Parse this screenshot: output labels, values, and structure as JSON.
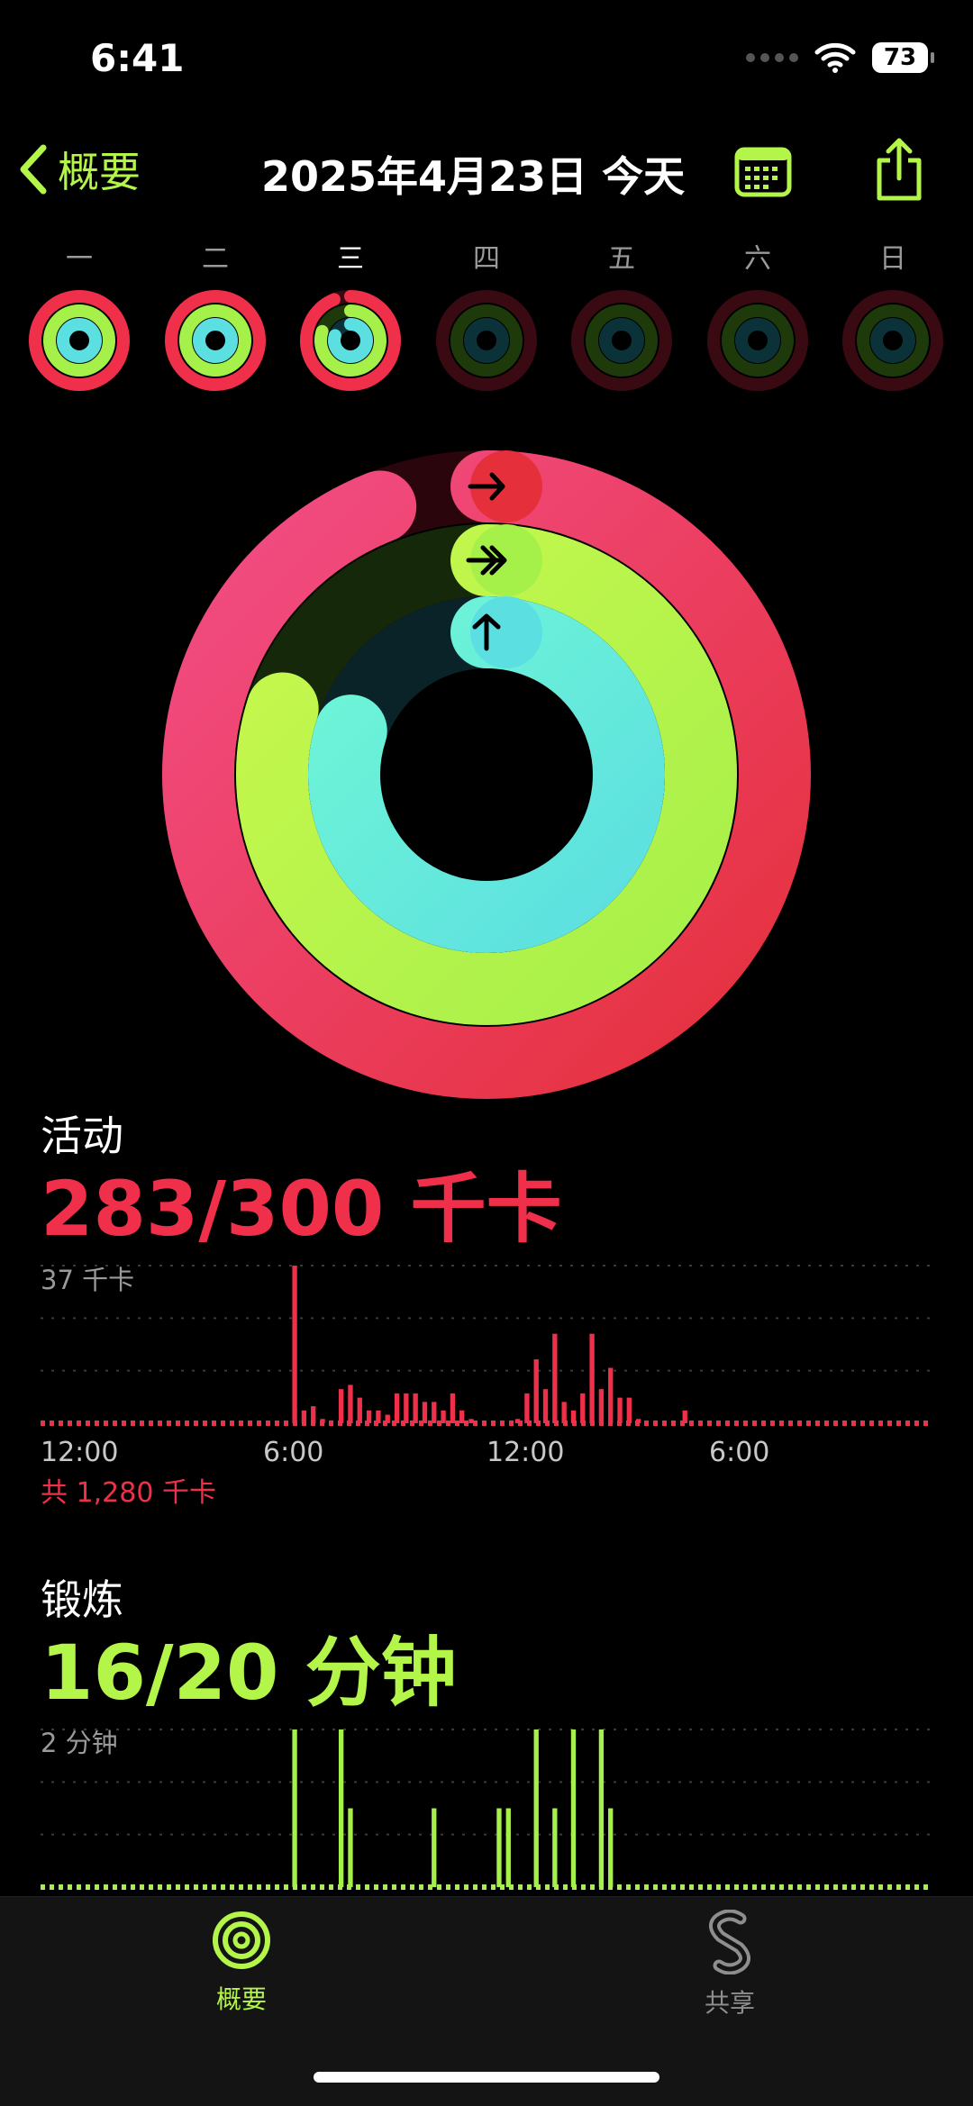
{
  "status": {
    "time": "6:41",
    "battery": "73"
  },
  "nav": {
    "back_label": "概要",
    "title": "2025年4月23日 今天"
  },
  "week": {
    "days": [
      "一",
      "二",
      "三",
      "四",
      "五",
      "六",
      "日"
    ],
    "today_index": 2,
    "rings": [
      {
        "move": 1.0,
        "exercise": 1.0,
        "stand": 1.0
      },
      {
        "move": 1.0,
        "exercise": 1.0,
        "stand": 1.0
      },
      {
        "move": 0.94,
        "exercise": 0.8,
        "stand": 0.8
      },
      {
        "move": 0,
        "exercise": 0,
        "stand": 0
      },
      {
        "move": 0,
        "exercise": 0,
        "stand": 0
      },
      {
        "move": 0,
        "exercise": 0,
        "stand": 0
      },
      {
        "move": 0,
        "exercise": 0,
        "stand": 0
      }
    ]
  },
  "rings": {
    "move": 0.94,
    "exercise": 0.8,
    "stand": 0.8
  },
  "colors": {
    "move": "#f0304a",
    "move_start": "#f24d86",
    "move_end": "#e5303c",
    "exercise": "#a6f04a",
    "exercise_start": "#c8f84d",
    "stand": "#5cdfe0",
    "stand_start": "#6ff6d6",
    "accent": "#b4f54a"
  },
  "activity": {
    "label": "活动",
    "value": "283/300 千卡",
    "chart_data": {
      "type": "bar",
      "max_label": "37 千卡",
      "x_ticks": [
        "12:00",
        "6:00",
        "12:00",
        "6:00"
      ],
      "total": "共 1,280 千卡",
      "values": [
        0,
        0,
        0,
        0,
        0,
        0,
        0,
        0,
        0,
        0,
        0,
        0,
        0,
        0,
        0,
        0,
        0,
        0,
        0,
        0,
        0,
        0,
        0,
        0,
        0,
        0,
        0,
        37,
        3,
        4,
        1,
        0,
        8,
        9,
        6,
        3,
        3,
        2,
        7,
        7,
        7,
        5,
        5,
        3,
        7,
        3,
        1,
        0,
        0,
        0,
        0,
        1,
        7,
        15,
        8,
        21,
        5,
        3,
        7,
        21,
        8,
        13,
        6,
        6,
        1,
        0,
        0,
        0,
        0,
        3,
        0,
        0,
        0,
        0,
        0,
        0,
        0,
        0,
        0,
        0,
        0,
        0,
        0,
        0,
        0,
        0,
        0,
        0,
        0,
        0,
        0,
        0,
        0,
        0,
        0,
        0
      ]
    }
  },
  "exercise": {
    "label": "锻炼",
    "value": "16/20 分钟",
    "chart_data": {
      "type": "bar",
      "max_label": "2 分钟",
      "values": [
        0,
        0,
        0,
        0,
        0,
        0,
        0,
        0,
        0,
        0,
        0,
        0,
        0,
        0,
        0,
        0,
        0,
        0,
        0,
        0,
        0,
        0,
        0,
        0,
        0,
        0,
        0,
        2,
        0,
        0,
        0,
        0,
        2,
        1,
        0,
        0,
        0,
        0,
        0,
        0,
        0,
        0,
        1,
        0,
        0,
        0,
        0,
        0,
        0,
        1,
        1,
        0,
        0,
        2,
        0,
        1,
        0,
        2,
        0,
        0,
        2,
        1,
        0,
        0,
        0,
        0,
        0,
        0,
        0,
        0,
        0,
        0,
        0,
        0,
        0,
        0,
        0,
        0,
        0,
        0,
        0,
        0,
        0,
        0,
        0,
        0,
        0,
        0,
        0,
        0,
        0,
        0,
        0,
        0,
        0,
        0
      ]
    }
  },
  "tabs": [
    {
      "label": "概要",
      "icon": "rings-icon",
      "active": true
    },
    {
      "label": "共享",
      "icon": "sharing-icon",
      "active": false
    }
  ]
}
